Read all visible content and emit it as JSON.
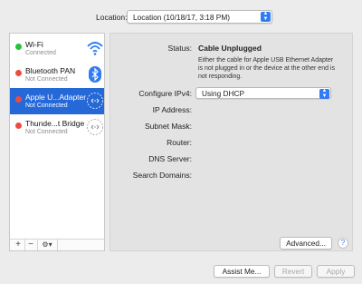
{
  "location": {
    "label": "Location:",
    "value": "Location (10/18/17, 3:18 PM)"
  },
  "services": [
    {
      "name": "Wi-Fi",
      "status": "Connected",
      "status_color": "#29c13b",
      "icon": "wifi-icon",
      "selected": false
    },
    {
      "name": "Bluetooth PAN",
      "status": "Not Connected",
      "status_color": "#ee4b3f",
      "icon": "bluetooth-icon",
      "selected": false
    },
    {
      "name": "Apple U...Adapter",
      "status": "Not Connected",
      "status_color": "#ee4b3f",
      "icon": "ethernet-icon",
      "selected": true
    },
    {
      "name": "Thunde...t Bridge",
      "status": "Not Connected",
      "status_color": "#ee4b3f",
      "icon": "ethernet-icon",
      "selected": false
    }
  ],
  "sidebar_toolbar": {
    "add": "+",
    "remove": "−",
    "action": "⚙▾"
  },
  "detail": {
    "status_label": "Status:",
    "status_value": "Cable Unplugged",
    "status_description": "Either the cable for Apple USB Ethernet Adapter is not plugged in or the device at the other end is not responding.",
    "configure_label": "Configure IPv4:",
    "configure_value": "Using DHCP",
    "ip_label": "IP Address:",
    "subnet_label": "Subnet Mask:",
    "router_label": "Router:",
    "dns_label": "DNS Server:",
    "search_label": "Search Domains:",
    "advanced_button": "Advanced...",
    "help": "?"
  },
  "footer": {
    "assist": "Assist Me...",
    "revert": "Revert",
    "apply": "Apply"
  },
  "colors": {
    "accent": "#2f7bf5",
    "selection": "#2568d8",
    "connected": "#29c13b",
    "not_connected": "#ee4b3f"
  }
}
